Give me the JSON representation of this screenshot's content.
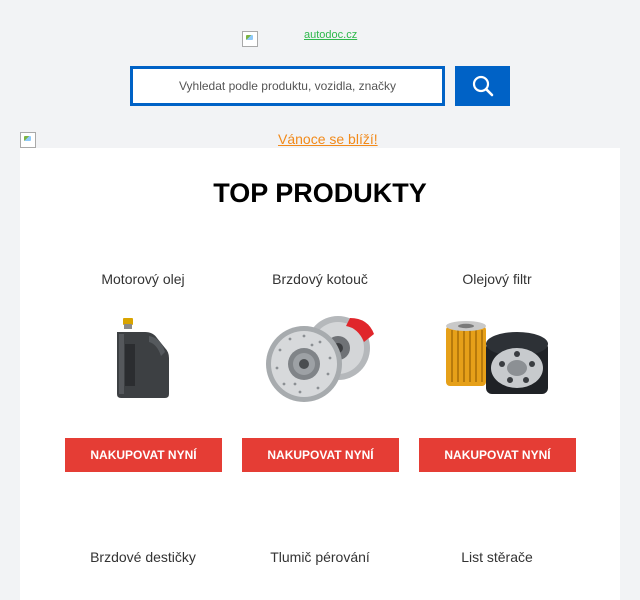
{
  "header": {
    "logo_text": "autodoc.cz"
  },
  "search": {
    "placeholder": "Vyhledat podle produktu, vozidla, značky",
    "icon": "search-icon"
  },
  "promo": {
    "link_text": "Vánoce se blíží!"
  },
  "section": {
    "title": "TOP PRODUKTY"
  },
  "products": [
    {
      "name": "Motorový olej",
      "button": "NAKUPOVAT NYNÍ",
      "icon": "engine-oil-canister-icon"
    },
    {
      "name": "Brzdový kotouč",
      "button": "NAKUPOVAT NYNÍ",
      "icon": "brake-disc-icon"
    },
    {
      "name": "Olejový filtr",
      "button": "NAKUPOVAT NYNÍ",
      "icon": "oil-filter-icon"
    },
    {
      "name": "Brzdové destičky"
    },
    {
      "name": "Tlumič pérování"
    },
    {
      "name": "List stěrače"
    }
  ],
  "colors": {
    "accent_blue": "#0062c6",
    "button_red": "#e53d35",
    "logo_green": "#2eb84b",
    "promo_orange": "#f28a1a"
  }
}
